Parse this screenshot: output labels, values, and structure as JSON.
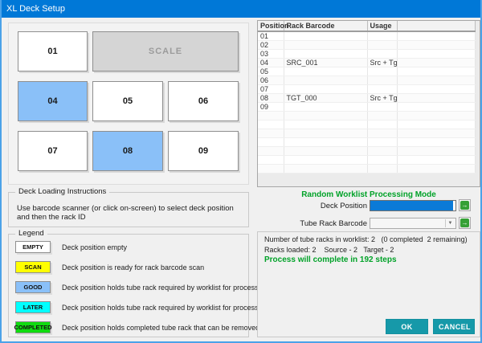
{
  "window": {
    "title": "XL Deck Setup"
  },
  "deck": {
    "positions": [
      {
        "id": "01",
        "state": "empty"
      },
      {
        "id": "SCALE",
        "state": "scale"
      },
      {
        "id": "04",
        "state": "good"
      },
      {
        "id": "05",
        "state": "empty"
      },
      {
        "id": "06",
        "state": "empty"
      },
      {
        "id": "07",
        "state": "empty"
      },
      {
        "id": "08",
        "state": "good"
      },
      {
        "id": "09",
        "state": "empty"
      }
    ]
  },
  "table": {
    "headers": [
      "Position",
      "Rack Barcode",
      "Usage",
      ""
    ],
    "rows": [
      {
        "position": "01",
        "barcode": "",
        "usage": ""
      },
      {
        "position": "02",
        "barcode": "",
        "usage": ""
      },
      {
        "position": "03",
        "barcode": "",
        "usage": ""
      },
      {
        "position": "04",
        "barcode": "SRC_001",
        "usage": "Src + Tgt"
      },
      {
        "position": "05",
        "barcode": "",
        "usage": ""
      },
      {
        "position": "06",
        "barcode": "",
        "usage": ""
      },
      {
        "position": "07",
        "barcode": "",
        "usage": ""
      },
      {
        "position": "08",
        "barcode": "TGT_000",
        "usage": "Src + Tgt"
      },
      {
        "position": "09",
        "barcode": "",
        "usage": ""
      },
      {
        "position": "",
        "barcode": "",
        "usage": ""
      },
      {
        "position": "",
        "barcode": "",
        "usage": ""
      },
      {
        "position": "",
        "barcode": "",
        "usage": ""
      },
      {
        "position": "",
        "barcode": "",
        "usage": ""
      },
      {
        "position": "",
        "barcode": "",
        "usage": ""
      },
      {
        "position": "",
        "barcode": "",
        "usage": ""
      },
      {
        "position": "",
        "barcode": "",
        "usage": ""
      }
    ]
  },
  "instructions": {
    "title": "Deck Loading Instructions",
    "text": "Use barcode scanner (or click on-screen) to select deck position and then the rack ID"
  },
  "legend": {
    "title": "Legend",
    "items": [
      {
        "label": "EMPTY",
        "color": "#FFFFFF",
        "text": "Deck position empty"
      },
      {
        "label": "SCAN",
        "color": "#FFFF00",
        "text": "Deck position is ready for rack barcode scan"
      },
      {
        "label": "GOOD",
        "color": "#8AC0F8",
        "text": "Deck position holds tube rack required by worklist for processing now"
      },
      {
        "label": "LATER",
        "color": "#00FFFF",
        "text": "Deck position holds tube rack required by worklist for processing at a later time"
      },
      {
        "label": "COMPLETED",
        "color": "#0FDB0F",
        "text": "Deck position holds completed tube rack that can be removed"
      }
    ]
  },
  "processing": {
    "mode_title": "Random Worklist Processing Mode",
    "deck_position_label": "Deck Position",
    "tube_rack_barcode_label": "Tube Rack Barcode",
    "deck_position_value": "",
    "tube_rack_barcode_value": ""
  },
  "status": {
    "line1": "Number of tube racks in worklist: 2   (0 completed  2 remaining)",
    "line2": "Racks loaded: 2    Source - 2   Target - 2",
    "line3": "Process will complete in 192 steps"
  },
  "buttons": {
    "ok": "OK",
    "cancel": "CANCEL"
  },
  "colors": {
    "titlebar": "#0078D7",
    "window_border": "#4BA2E8",
    "accent_green_text": "#00A228",
    "button_teal": "#1699A9",
    "good_blue": "#8AC0F8",
    "scan_yellow": "#FFFF00",
    "later_cyan": "#00FFFF",
    "completed_green": "#0FDB0F",
    "deck_position_fill": "#0B7AD7"
  }
}
